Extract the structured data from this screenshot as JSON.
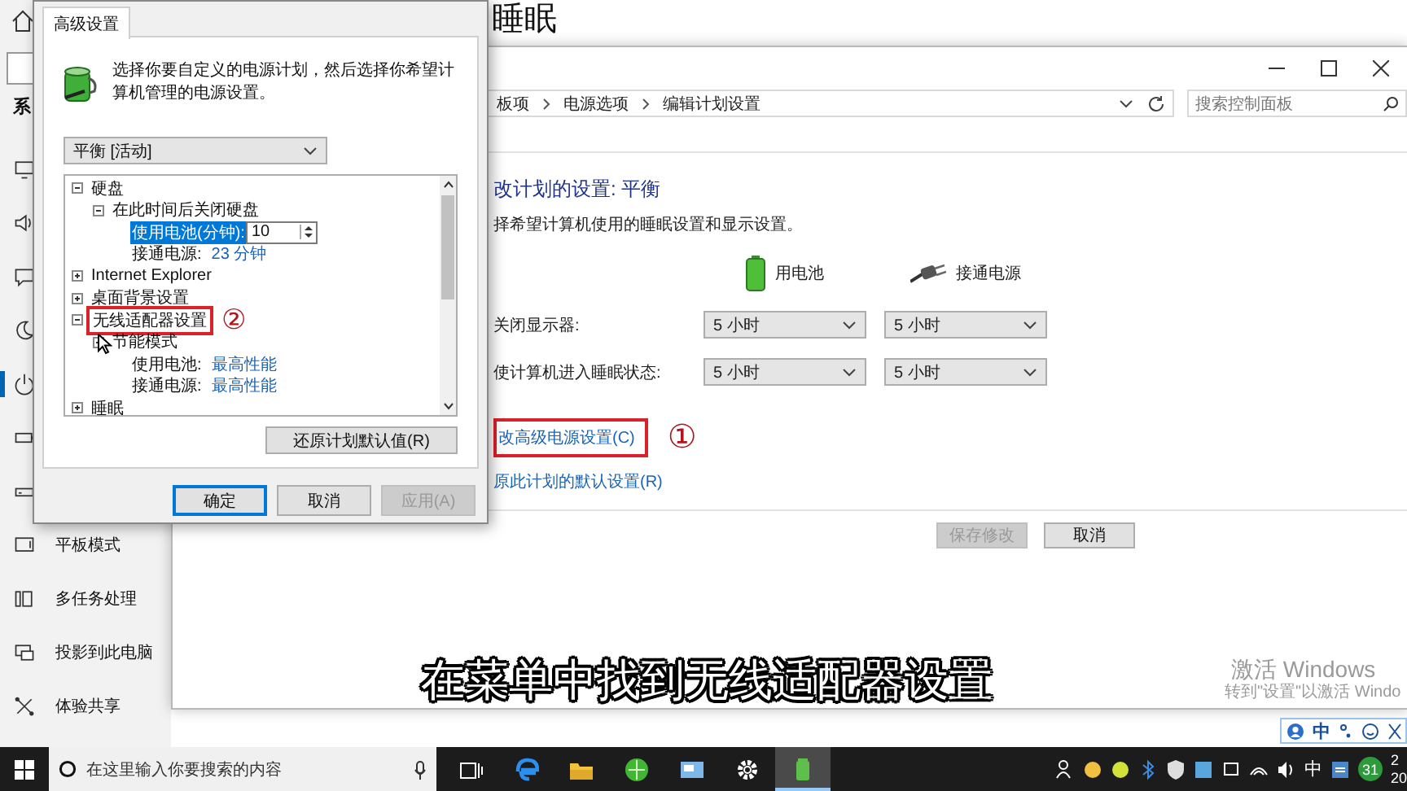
{
  "settings_window": {
    "title": "睡眠",
    "section_heading": "系",
    "nav_items": [
      {
        "selected": false
      },
      {
        "selected": false
      },
      {
        "selected": false
      },
      {
        "selected": false
      },
      {
        "selected": true
      },
      {
        "selected": false
      },
      {
        "selected": false
      },
      {
        "label": "平板模式",
        "selected": false
      },
      {
        "label": "多任务处理",
        "selected": false
      },
      {
        "label": "投影到此电脑",
        "selected": false
      },
      {
        "label": "体验共享",
        "selected": false
      }
    ]
  },
  "control_panel": {
    "breadcrumb": [
      "板项",
      "电源选项",
      "编辑计划设置"
    ],
    "search_placeholder": "搜索控制面板",
    "heading": "改计划的设置: 平衡",
    "subtitle": "择希望计算机使用的睡眠设置和显示设置。",
    "columns": [
      "用电池",
      "接通电源"
    ],
    "settings": [
      {
        "label": "关闭显示器:",
        "values": [
          "5 小时",
          "5 小时"
        ]
      },
      {
        "label": "使计算机进入睡眠状态:",
        "values": [
          "5 小时",
          "5 小时"
        ]
      }
    ],
    "links": [
      {
        "text": "改高级电源设置(C)",
        "annotation": "①"
      },
      {
        "text": "原此计划的默认设置(R)"
      }
    ],
    "buttons": [
      {
        "label": "保存修改",
        "disabled": true
      },
      {
        "label": "取消",
        "disabled": false
      }
    ]
  },
  "dialog": {
    "tab": "高级设置",
    "description": "选择你要自定义的电源计划，然后选择你希望计算机管理的电源设置。",
    "plan_dropdown": "平衡 [活动]",
    "tree": [
      {
        "label": "硬盘",
        "expanded": true,
        "children": [
          {
            "label": "在此时间后关闭硬盘",
            "expanded": true,
            "children": [
              {
                "label": "使用电池(分钟):",
                "kind": "spin",
                "value": "10",
                "selected": true
              },
              {
                "label": "接通电源:",
                "kind": "link",
                "value": "23 分钟",
                "selected": false
              }
            ]
          }
        ]
      },
      {
        "label": "Internet Explorer",
        "expanded": false
      },
      {
        "label": "桌面背景设置",
        "expanded": false
      },
      {
        "label": "无线适配器设置",
        "expanded": true,
        "annotation": "②",
        "children": [
          {
            "label": "节能模式",
            "expanded": true,
            "children": [
              {
                "label": "使用电池:",
                "kind": "link",
                "value": "最高性能",
                "selected": false
              },
              {
                "label": "接通电源:",
                "kind": "link",
                "value": "最高性能",
                "selected": false
              }
            ]
          }
        ]
      },
      {
        "label": "睡眠",
        "expanded": false
      }
    ],
    "restore_button": "还原计划默认值(R)",
    "buttons": [
      {
        "label": "确定",
        "default": true,
        "disabled": false
      },
      {
        "label": "取消",
        "default": false,
        "disabled": false
      },
      {
        "label": "应用(A)",
        "default": false,
        "disabled": true
      }
    ]
  },
  "caption": "在菜单中找到无线适配器设置",
  "activation": {
    "title": "激活 Windows",
    "hint": "转到\"设置\"以激活 Windo"
  },
  "ime_bar": {
    "mode": "中"
  },
  "taskbar": {
    "search_placeholder": "在这里输入你要搜索的内容",
    "apps": [
      {
        "active": false
      },
      {
        "active": false
      },
      {
        "active": false
      },
      {
        "active": false
      },
      {
        "active": false
      },
      {
        "active": false
      },
      {
        "active": true
      }
    ],
    "ime": "中",
    "calendar_badge": "31",
    "clock_time": "2",
    "clock_date": "20"
  }
}
